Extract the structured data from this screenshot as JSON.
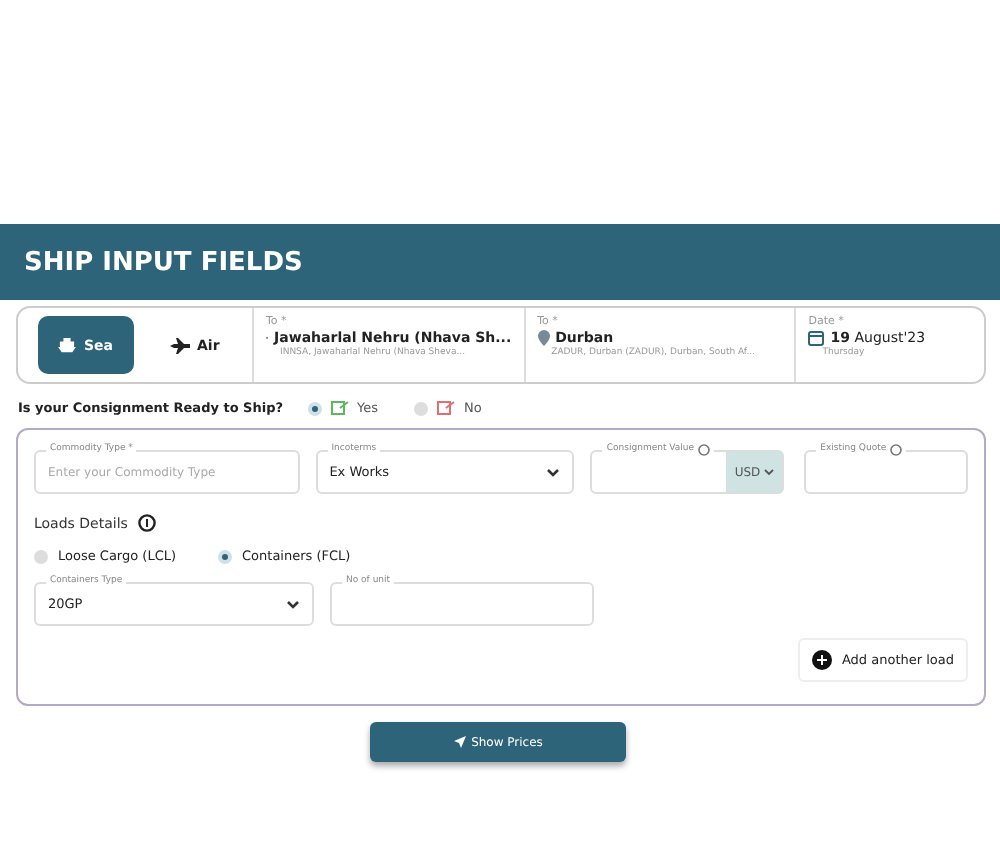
{
  "header": {
    "title": "SHIP INPUT FIELDS"
  },
  "modes": [
    {
      "label": "Sea",
      "kind": "ship",
      "selected": true
    },
    {
      "label": "Air",
      "kind": "plane",
      "selected": false
    }
  ],
  "route": [
    {
      "label": "To *",
      "value": "Jawaharlal Nehru (Nhava Sh...",
      "detail": "INNSA, Jawaharlal Nehru (Nhava Sheva..."
    },
    {
      "label": "To *",
      "value": "Durban",
      "detail": "ZADUR, Durban (ZADUR), Durban, South Af..."
    }
  ],
  "date": {
    "label": "Date *",
    "value": "19 August'23",
    "detail": "Thursday"
  },
  "ready": {
    "question": "Is your Consignment Ready to Ship?",
    "options": [
      {
        "label": "Yes",
        "selected": true
      },
      {
        "label": "No",
        "selected": false
      }
    ]
  },
  "fields": [
    {
      "label": "Commodity Type *",
      "placeholder": "Enter your Commodity Type",
      "kind": "text"
    },
    {
      "label": "Incoterms",
      "value": "Ex Works",
      "kind": "select"
    },
    {
      "label": "Consignment Value",
      "currency": "USD",
      "kind": "money"
    },
    {
      "label": "Existing Quote",
      "kind": "info"
    }
  ],
  "loads": {
    "title": "Loads Details",
    "options": [
      {
        "label": "Loose Cargo (LCL)",
        "selected": false
      },
      {
        "label": "Containers (FCL)",
        "selected": true
      }
    ],
    "fields": [
      {
        "label": "Containers Type",
        "value": "20GP",
        "kind": "select"
      },
      {
        "label": "No of unit",
        "kind": "text"
      }
    ],
    "add_button": "Add another load"
  },
  "submit": "Show Prices"
}
